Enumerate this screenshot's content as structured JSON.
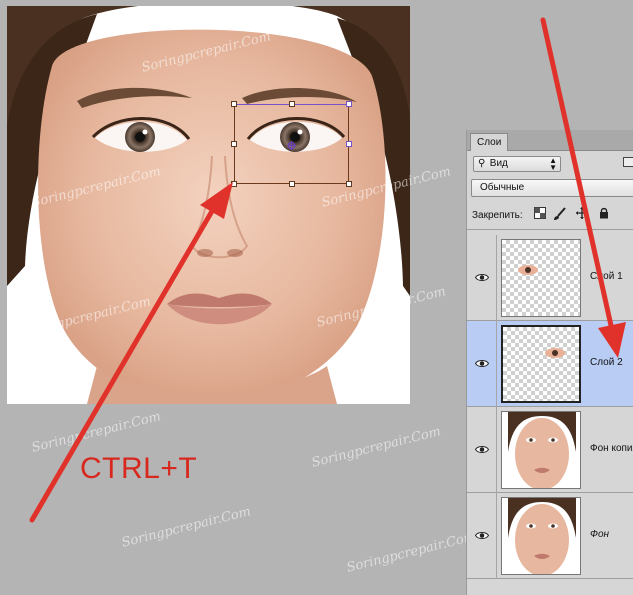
{
  "canvas": {
    "hotkey_text": "CTRL+T",
    "accent_color": "#d8281e",
    "watermark_text": "Soringpcrepair.Com"
  },
  "layers_panel": {
    "tab_label": "Слои",
    "filter": {
      "value": "Вид"
    },
    "blend_mode": {
      "value": "Обычные"
    },
    "lock_label": "Закрепить:",
    "layers": [
      {
        "name": "Слой 1",
        "visible": true,
        "selected": false,
        "italic": false
      },
      {
        "name": "Слой 2",
        "visible": true,
        "selected": true,
        "italic": false
      },
      {
        "name": "Фон копия",
        "visible": true,
        "selected": false,
        "italic": false
      },
      {
        "name": "Фон",
        "visible": true,
        "selected": false,
        "italic": true
      }
    ]
  }
}
